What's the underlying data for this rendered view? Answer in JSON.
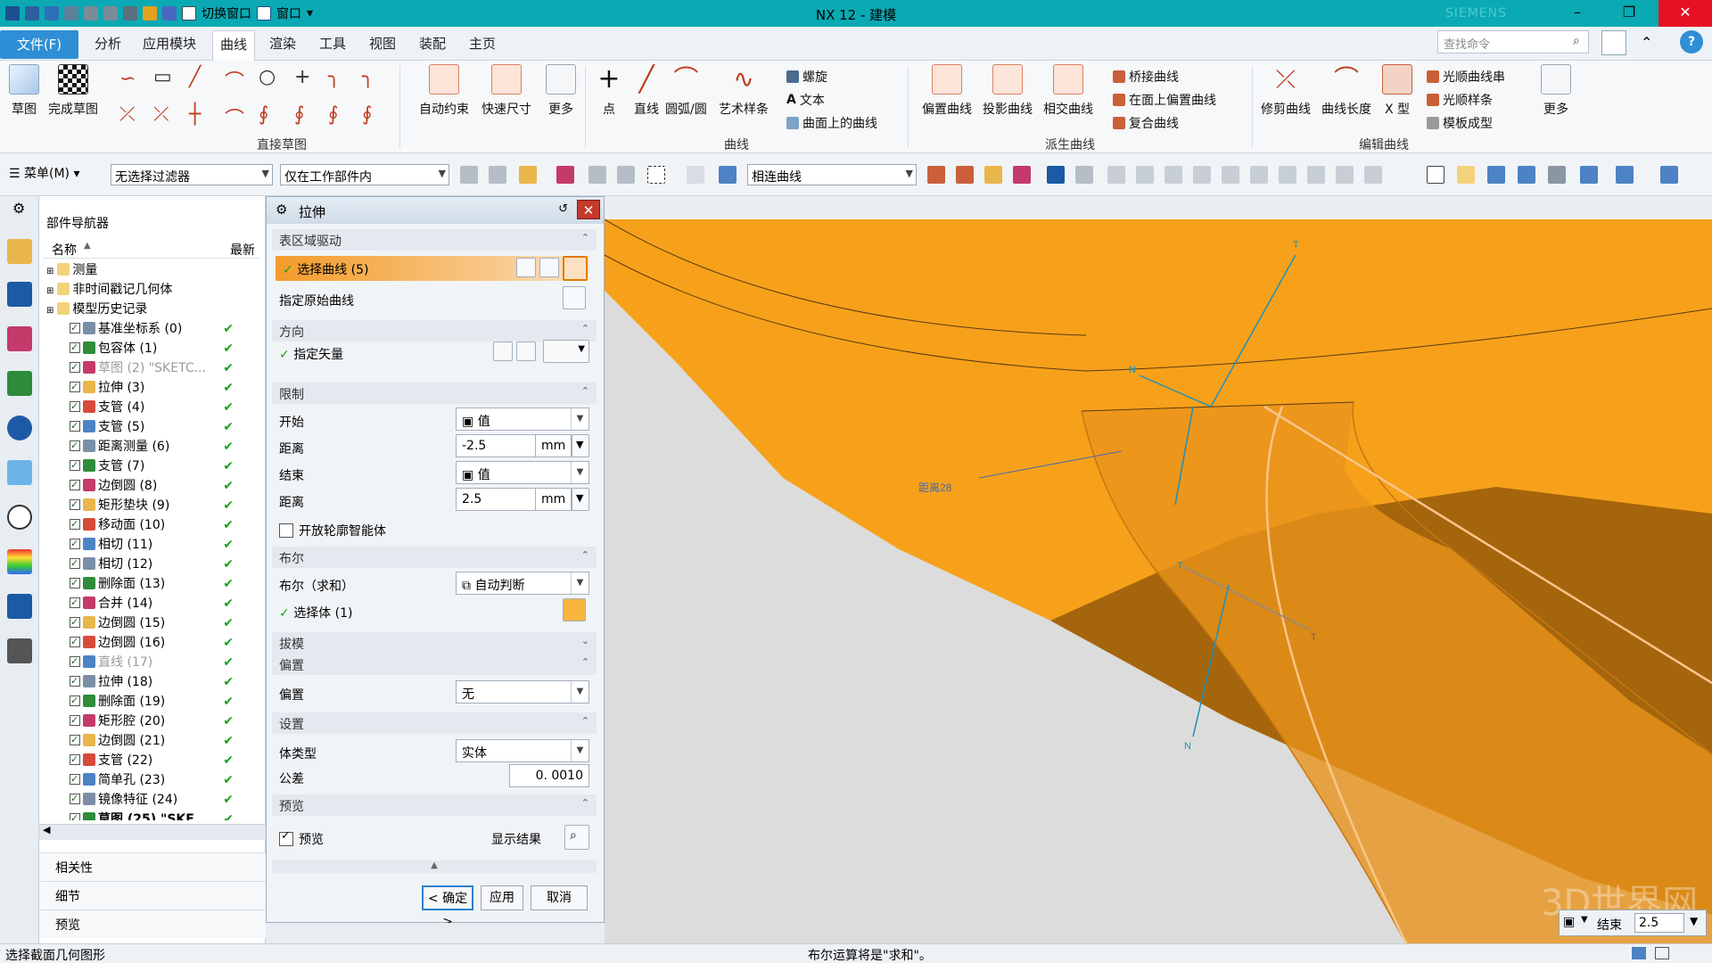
{
  "window": {
    "title": "NX 12 - 建模",
    "brand": "SIEMENS",
    "quick_access": {
      "switch_window": "切换窗口",
      "window_menu": "窗口"
    }
  },
  "menu_tabs": [
    "文件(F)",
    "分析",
    "应用模块",
    "曲线",
    "渲染",
    "工具",
    "视图",
    "装配",
    "主页"
  ],
  "active_tab": "曲线",
  "search_placeholder": "查找命令",
  "ribbon": {
    "sketch_group": {
      "label": "直接草图",
      "buttons": [
        "草图",
        "完成草图"
      ]
    },
    "constraint_buttons": [
      "自动约束",
      "快速尺寸",
      "更多"
    ],
    "curve_group": {
      "label": "曲线",
      "buttons": [
        "点",
        "直线",
        "圆弧/圆",
        "艺术样条"
      ],
      "small": [
        "螺旋",
        "文本",
        "曲面上的曲线"
      ]
    },
    "derived_group": {
      "label": "派生曲线",
      "buttons": [
        "偏置曲线",
        "投影曲线",
        "相交曲线"
      ],
      "small": [
        "桥接曲线",
        "在面上偏置曲线",
        "复合曲线"
      ]
    },
    "edit_group": {
      "label": "编辑曲线",
      "buttons": [
        "修剪曲线",
        "曲线长度",
        "X 型"
      ],
      "small": [
        "光顺曲线串",
        "光顺样条",
        "模板成型"
      ],
      "more": "更多"
    }
  },
  "toolbar2": {
    "menu_label": "菜单(M)",
    "filter": "无选择过滤器",
    "scope": "仅在工作部件内",
    "curve_rule": "相连曲线"
  },
  "navigator": {
    "title": "部件导航器",
    "col_name": "名称",
    "col_latest": "最新",
    "items": [
      {
        "label": "测量",
        "level": 0,
        "checked": false,
        "dim": false,
        "bold": false,
        "ok": false
      },
      {
        "label": "非时间戳记几何体",
        "level": 0,
        "checked": false,
        "dim": false,
        "bold": false,
        "ok": false
      },
      {
        "label": "模型历史记录",
        "level": 0,
        "checked": false,
        "dim": false,
        "bold": false,
        "ok": false
      },
      {
        "label": "基准坐标系 (0)",
        "level": 1,
        "checked": true,
        "dim": false,
        "bold": false,
        "ok": true
      },
      {
        "label": "包容体 (1)",
        "level": 1,
        "checked": true,
        "dim": false,
        "bold": false,
        "ok": true
      },
      {
        "label": "草图 (2) \"SKETC...",
        "level": 1,
        "checked": true,
        "dim": true,
        "bold": false,
        "ok": true
      },
      {
        "label": "拉伸 (3)",
        "level": 1,
        "checked": true,
        "dim": false,
        "bold": false,
        "ok": true
      },
      {
        "label": "支管 (4)",
        "level": 1,
        "checked": true,
        "dim": false,
        "bold": false,
        "ok": true
      },
      {
        "label": "支管 (5)",
        "level": 1,
        "checked": true,
        "dim": false,
        "bold": false,
        "ok": true
      },
      {
        "label": "距离测量 (6)",
        "level": 1,
        "checked": true,
        "dim": false,
        "bold": false,
        "ok": true
      },
      {
        "label": "支管 (7)",
        "level": 1,
        "checked": true,
        "dim": false,
        "bold": false,
        "ok": true
      },
      {
        "label": "边倒圆 (8)",
        "level": 1,
        "checked": true,
        "dim": false,
        "bold": false,
        "ok": true
      },
      {
        "label": "矩形垫块 (9)",
        "level": 1,
        "checked": true,
        "dim": false,
        "bold": false,
        "ok": true
      },
      {
        "label": "移动面 (10)",
        "level": 1,
        "checked": true,
        "dim": false,
        "bold": false,
        "ok": true
      },
      {
        "label": "相切 (11)",
        "level": 1,
        "checked": true,
        "dim": false,
        "bold": false,
        "ok": true
      },
      {
        "label": "相切 (12)",
        "level": 1,
        "checked": true,
        "dim": false,
        "bold": false,
        "ok": true
      },
      {
        "label": "删除面 (13)",
        "level": 1,
        "checked": true,
        "dim": false,
        "bold": false,
        "ok": true
      },
      {
        "label": "合并 (14)",
        "level": 1,
        "checked": true,
        "dim": false,
        "bold": false,
        "ok": true
      },
      {
        "label": "边倒圆 (15)",
        "level": 1,
        "checked": true,
        "dim": false,
        "bold": false,
        "ok": true
      },
      {
        "label": "边倒圆 (16)",
        "level": 1,
        "checked": true,
        "dim": false,
        "bold": false,
        "ok": true
      },
      {
        "label": "直线 (17)",
        "level": 1,
        "checked": true,
        "dim": true,
        "bold": false,
        "ok": true
      },
      {
        "label": "拉伸 (18)",
        "level": 1,
        "checked": true,
        "dim": false,
        "bold": false,
        "ok": true
      },
      {
        "label": "删除面 (19)",
        "level": 1,
        "checked": true,
        "dim": false,
        "bold": false,
        "ok": true
      },
      {
        "label": "矩形腔 (20)",
        "level": 1,
        "checked": true,
        "dim": false,
        "bold": false,
        "ok": true
      },
      {
        "label": "边倒圆 (21)",
        "level": 1,
        "checked": true,
        "dim": false,
        "bold": false,
        "ok": true
      },
      {
        "label": "支管 (22)",
        "level": 1,
        "checked": true,
        "dim": false,
        "bold": false,
        "ok": true
      },
      {
        "label": "简单孔 (23)",
        "level": 1,
        "checked": true,
        "dim": false,
        "bold": false,
        "ok": true
      },
      {
        "label": "镜像特征 (24)",
        "level": 1,
        "checked": true,
        "dim": false,
        "bold": false,
        "ok": true
      },
      {
        "label": "草图 (25) \"SKE...",
        "level": 1,
        "checked": true,
        "dim": false,
        "bold": true,
        "ok": true
      }
    ],
    "sections": [
      "相关性",
      "细节",
      "预览"
    ]
  },
  "dialog": {
    "title": "拉伸",
    "sec_section": "表区域驱动",
    "select_curve": "选择曲线 (5)",
    "origin_curve": "指定原始曲线",
    "sec_direction": "方向",
    "specify_vector": "指定矢量",
    "sec_limits": "限制",
    "start_label": "开始",
    "start_value": "值",
    "distance_label": "距离",
    "start_distance": "-2.5",
    "end_label": "结束",
    "end_value": "值",
    "end_distance": "2.5",
    "unit": "mm",
    "open_profile": "开放轮廓智能体",
    "sec_boolean": "布尔",
    "boolean_label": "布尔（求和）",
    "boolean_value": "自动判断",
    "select_body": "选择体 (1)",
    "sec_draft": "拔模",
    "sec_offset": "偏置",
    "offset_label": "偏置",
    "offset_value": "无",
    "sec_settings": "设置",
    "body_type_label": "体类型",
    "body_type_value": "实体",
    "tolerance_label": "公差",
    "tolerance_value": "0. 0010",
    "sec_preview": "预览",
    "preview_label": "预览",
    "show_result": "显示结果",
    "ok": "< 确定 >",
    "apply": "应用",
    "cancel": "取消"
  },
  "viewport": {
    "dimension_text": "距离28",
    "handle_labels": [
      "T",
      "N",
      "T",
      "N",
      "T"
    ],
    "watermark": "3D世界网",
    "end_label": "结束",
    "end_value": "2.5"
  },
  "status": {
    "left": "选择截面几何图形",
    "center": "布尔运算将是\"求和\"。"
  },
  "colors": {
    "orange": "#f7a41d",
    "teal": "#0aa9b3",
    "dark_orange": "#7a4607"
  }
}
